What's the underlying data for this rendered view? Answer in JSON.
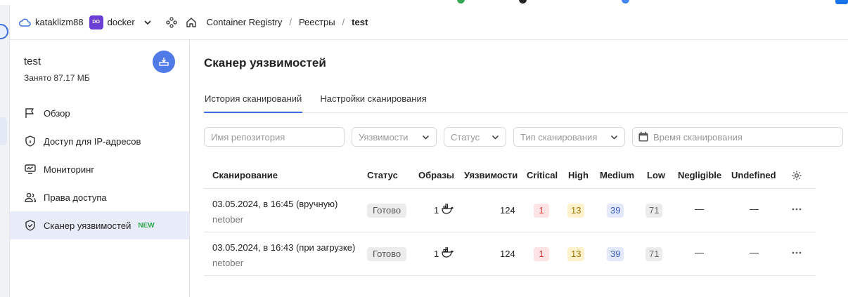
{
  "topbar": {
    "cloud_name": "kataklizm88",
    "folder_badge": "DO",
    "folder_name": "docker",
    "breadcrumbs": [
      "Container Registry",
      "Реестры",
      "test"
    ]
  },
  "sidebar": {
    "registry_name": "test",
    "registry_used": "Занято 87.17 МБ",
    "items": [
      {
        "label": "Обзор",
        "icon": "flag-icon"
      },
      {
        "label": "Доступ для IP-адресов",
        "icon": "shield-icon"
      },
      {
        "label": "Мониторинг",
        "icon": "monitor-icon"
      },
      {
        "label": "Права доступа",
        "icon": "users-icon"
      },
      {
        "label": "Сканер уязвимостей",
        "icon": "shield-check-icon",
        "badge": "NEW",
        "active": true
      }
    ]
  },
  "main": {
    "title": "Сканер уязвимостей",
    "tabs": [
      {
        "label": "История сканирований",
        "active": true
      },
      {
        "label": "Настройки сканирования",
        "active": false
      }
    ],
    "filters": {
      "repo_placeholder": "Имя репозитория",
      "vuln_placeholder": "Уязвимости",
      "status_placeholder": "Статус",
      "scan_type_placeholder": "Тип сканирования",
      "time_placeholder": "Время сканирования"
    },
    "table": {
      "headers": [
        "Сканирование",
        "Статус",
        "Образы",
        "Уязвимости",
        "Critical",
        "High",
        "Medium",
        "Low",
        "Negligible",
        "Undefined"
      ],
      "rows": [
        {
          "scan": "03.05.2024, в 16:45 (вручную)",
          "user": "netober",
          "status": "Готово",
          "images": "1",
          "vulns": "124",
          "critical": "1",
          "high": "13",
          "medium": "39",
          "low": "71",
          "negligible": "—",
          "undefined": "—"
        },
        {
          "scan": "03.05.2024, в 16:43 (при загрузке)",
          "user": "netober",
          "status": "Готово",
          "images": "1",
          "vulns": "124",
          "critical": "1",
          "high": "13",
          "medium": "39",
          "low": "71",
          "negligible": "—",
          "undefined": "—"
        }
      ]
    }
  },
  "colors": {
    "accent": "#3d6fe0",
    "active_nav_bg": "#e8ecf8",
    "new_badge": "#2fa84f",
    "critical": "#d43b3b",
    "high": "#9b7300",
    "medium": "#3a5fc2"
  }
}
